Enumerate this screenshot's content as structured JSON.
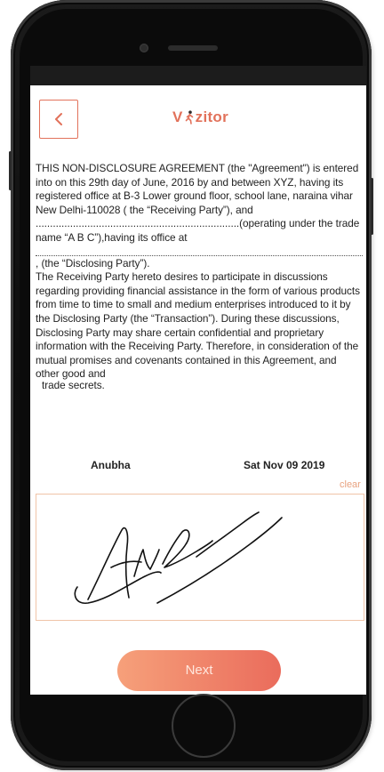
{
  "header": {
    "brand_name_prefix": "V",
    "brand_name_suffix": "zitor",
    "back_icon": "chevron-left-icon",
    "logo_icon": "walking-person-icon"
  },
  "agreement": {
    "paragraph_1": "THIS NON-DISCLOSURE AGREEMENT (the \"Agreement\") is entered into on this 29th day of June, 2016 by and between XYZ, having its registered office at B-3 Lower ground floor, school lane, naraina vihar New Delhi-110028 ( the “Receiving Party”), and .......................................................................(operating under the trade name “A B C”),having its office at",
    "paragraph_2": ", (the “Disclosing Party”).",
    "paragraph_3": "The Receiving Party hereto desires to participate in discussions regarding providing financial assistance in the form of various products from time to time to small and medium enterprises introduced to it by the Disclosing Party (the “Transaction”). During these discussions, Disclosing Party may share certain confidential and proprietary information with the Receiving Party. Therefore, in consideration of the mutual promises and covenants contained in this Agreement, and other good and",
    "paragraph_4": "trade secrets."
  },
  "signer": {
    "name": "Anubha",
    "date": "Sat Nov 09 2019"
  },
  "signature": {
    "clear_label": "clear",
    "ink_color": "#111111"
  },
  "actions": {
    "next_label": "Next"
  },
  "colors": {
    "accent": "#e2725b",
    "button_gradient_start": "#f6a07a",
    "button_gradient_end": "#ea6c5c",
    "clear_link": "#e8a27f"
  }
}
